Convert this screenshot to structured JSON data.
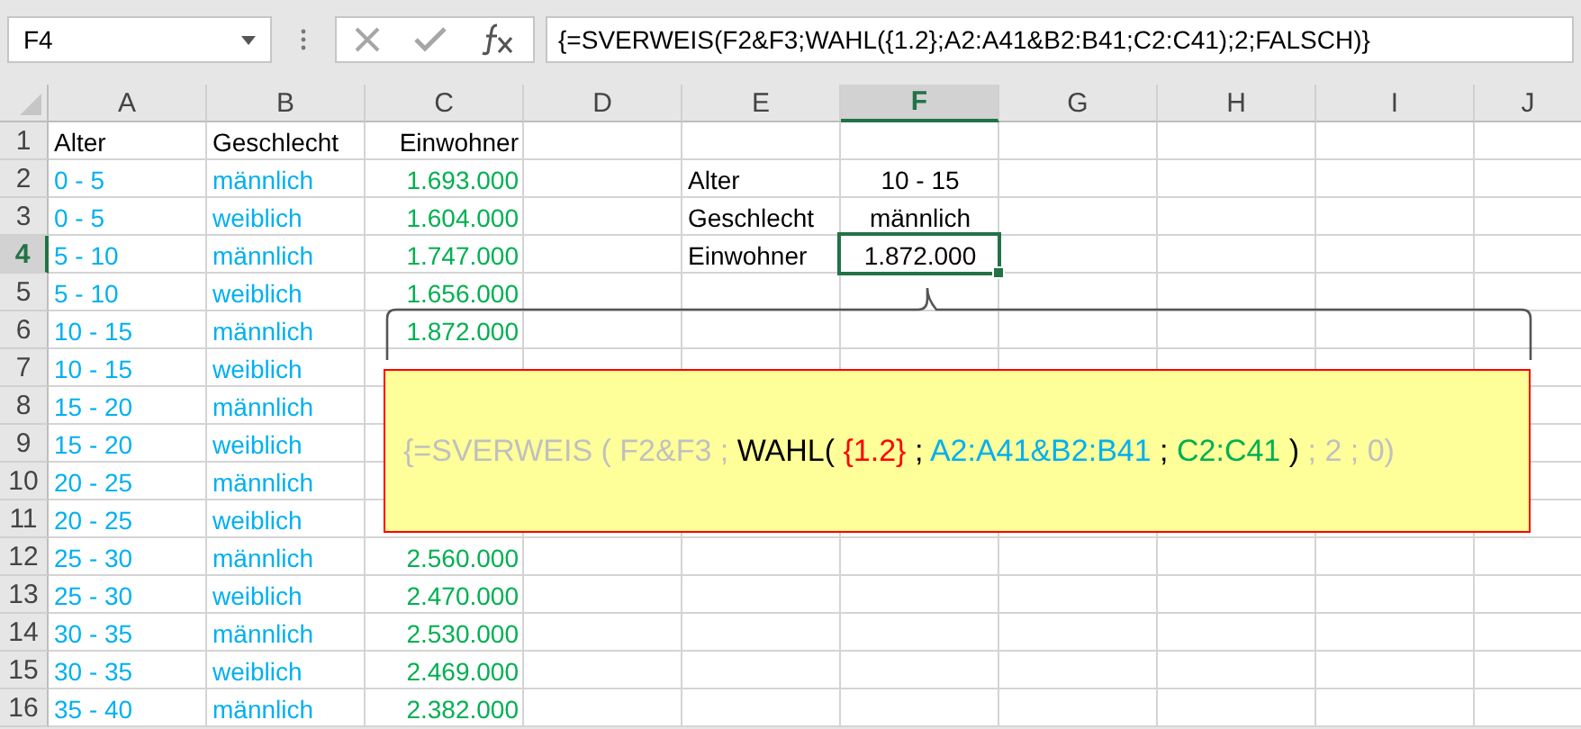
{
  "name_box": {
    "value": "F4"
  },
  "formula_bar": {
    "value": "{=SVERWEIS(F2&F3;WAHL({1.2};A2:A41&B2:B41;C2:C41);2;FALSCH)}"
  },
  "columns": [
    {
      "label": "A",
      "selected": false
    },
    {
      "label": "B",
      "selected": false
    },
    {
      "label": "C",
      "selected": false
    },
    {
      "label": "D",
      "selected": false
    },
    {
      "label": "E",
      "selected": false
    },
    {
      "label": "F",
      "selected": true
    },
    {
      "label": "G",
      "selected": false
    },
    {
      "label": "H",
      "selected": false
    },
    {
      "label": "I",
      "selected": false
    },
    {
      "label": "J",
      "selected": false
    }
  ],
  "rows": [
    {
      "number": "1",
      "selected": false,
      "a": "Alter",
      "b": "Geschlecht",
      "c": "Einwohner"
    },
    {
      "number": "2",
      "selected": false,
      "a": "0 - 5",
      "b": "männlich",
      "c": "1.693.000",
      "e": "Alter",
      "f": "10 - 15"
    },
    {
      "number": "3",
      "selected": false,
      "a": "0 - 5",
      "b": "weiblich",
      "c": "1.604.000",
      "e": "Geschlecht",
      "f": "männlich"
    },
    {
      "number": "4",
      "selected": true,
      "a": "5 - 10",
      "b": "männlich",
      "c": "1.747.000",
      "e": "Einwohner",
      "f": "1.872.000"
    },
    {
      "number": "5",
      "selected": false,
      "a": "5 - 10",
      "b": "weiblich",
      "c": "1.656.000"
    },
    {
      "number": "6",
      "selected": false,
      "a": "10 - 15",
      "b": "männlich",
      "c": "1.872.000"
    },
    {
      "number": "7",
      "selected": false,
      "a": "10 - 15",
      "b": "weiblich"
    },
    {
      "number": "8",
      "selected": false,
      "a": "15 - 20",
      "b": "männlich"
    },
    {
      "number": "9",
      "selected": false,
      "a": "15 - 20",
      "b": "weiblich"
    },
    {
      "number": "10",
      "selected": false,
      "a": "20 - 25",
      "b": "männlich"
    },
    {
      "number": "11",
      "selected": false,
      "a": "20 - 25",
      "b": "weiblich"
    },
    {
      "number": "12",
      "selected": false,
      "a": "25 - 30",
      "b": "männlich",
      "c": "2.560.000"
    },
    {
      "number": "13",
      "selected": false,
      "a": "25 - 30",
      "b": "weiblich",
      "c": "2.470.000"
    },
    {
      "number": "14",
      "selected": false,
      "a": "30 - 35",
      "b": "männlich",
      "c": "2.530.000"
    },
    {
      "number": "15",
      "selected": false,
      "a": "30 - 35",
      "b": "weiblich",
      "c": "2.469.000"
    },
    {
      "number": "16",
      "selected": false,
      "a": "35 - 40",
      "b": "männlich",
      "c": "2.382.000"
    }
  ],
  "callout": {
    "segments": [
      {
        "text": "{=SVERWEIS ( F2&F3 ; ",
        "color": "#c0c0c0"
      },
      {
        "text": "WAHL( ",
        "color": "#000000"
      },
      {
        "text": "{1.2}",
        "color": "#ff0000"
      },
      {
        "text": " ; ",
        "color": "#000000"
      },
      {
        "text": "A2:A41&B2:B41",
        "color": "#00b0f0"
      },
      {
        "text": " ; ",
        "color": "#000000"
      },
      {
        "text": "C2:C41",
        "color": "#00b050"
      },
      {
        "text": " )",
        "color": "#000000"
      },
      {
        "text": " ; 2 ; 0)",
        "color": "#c0c0c0"
      }
    ]
  }
}
